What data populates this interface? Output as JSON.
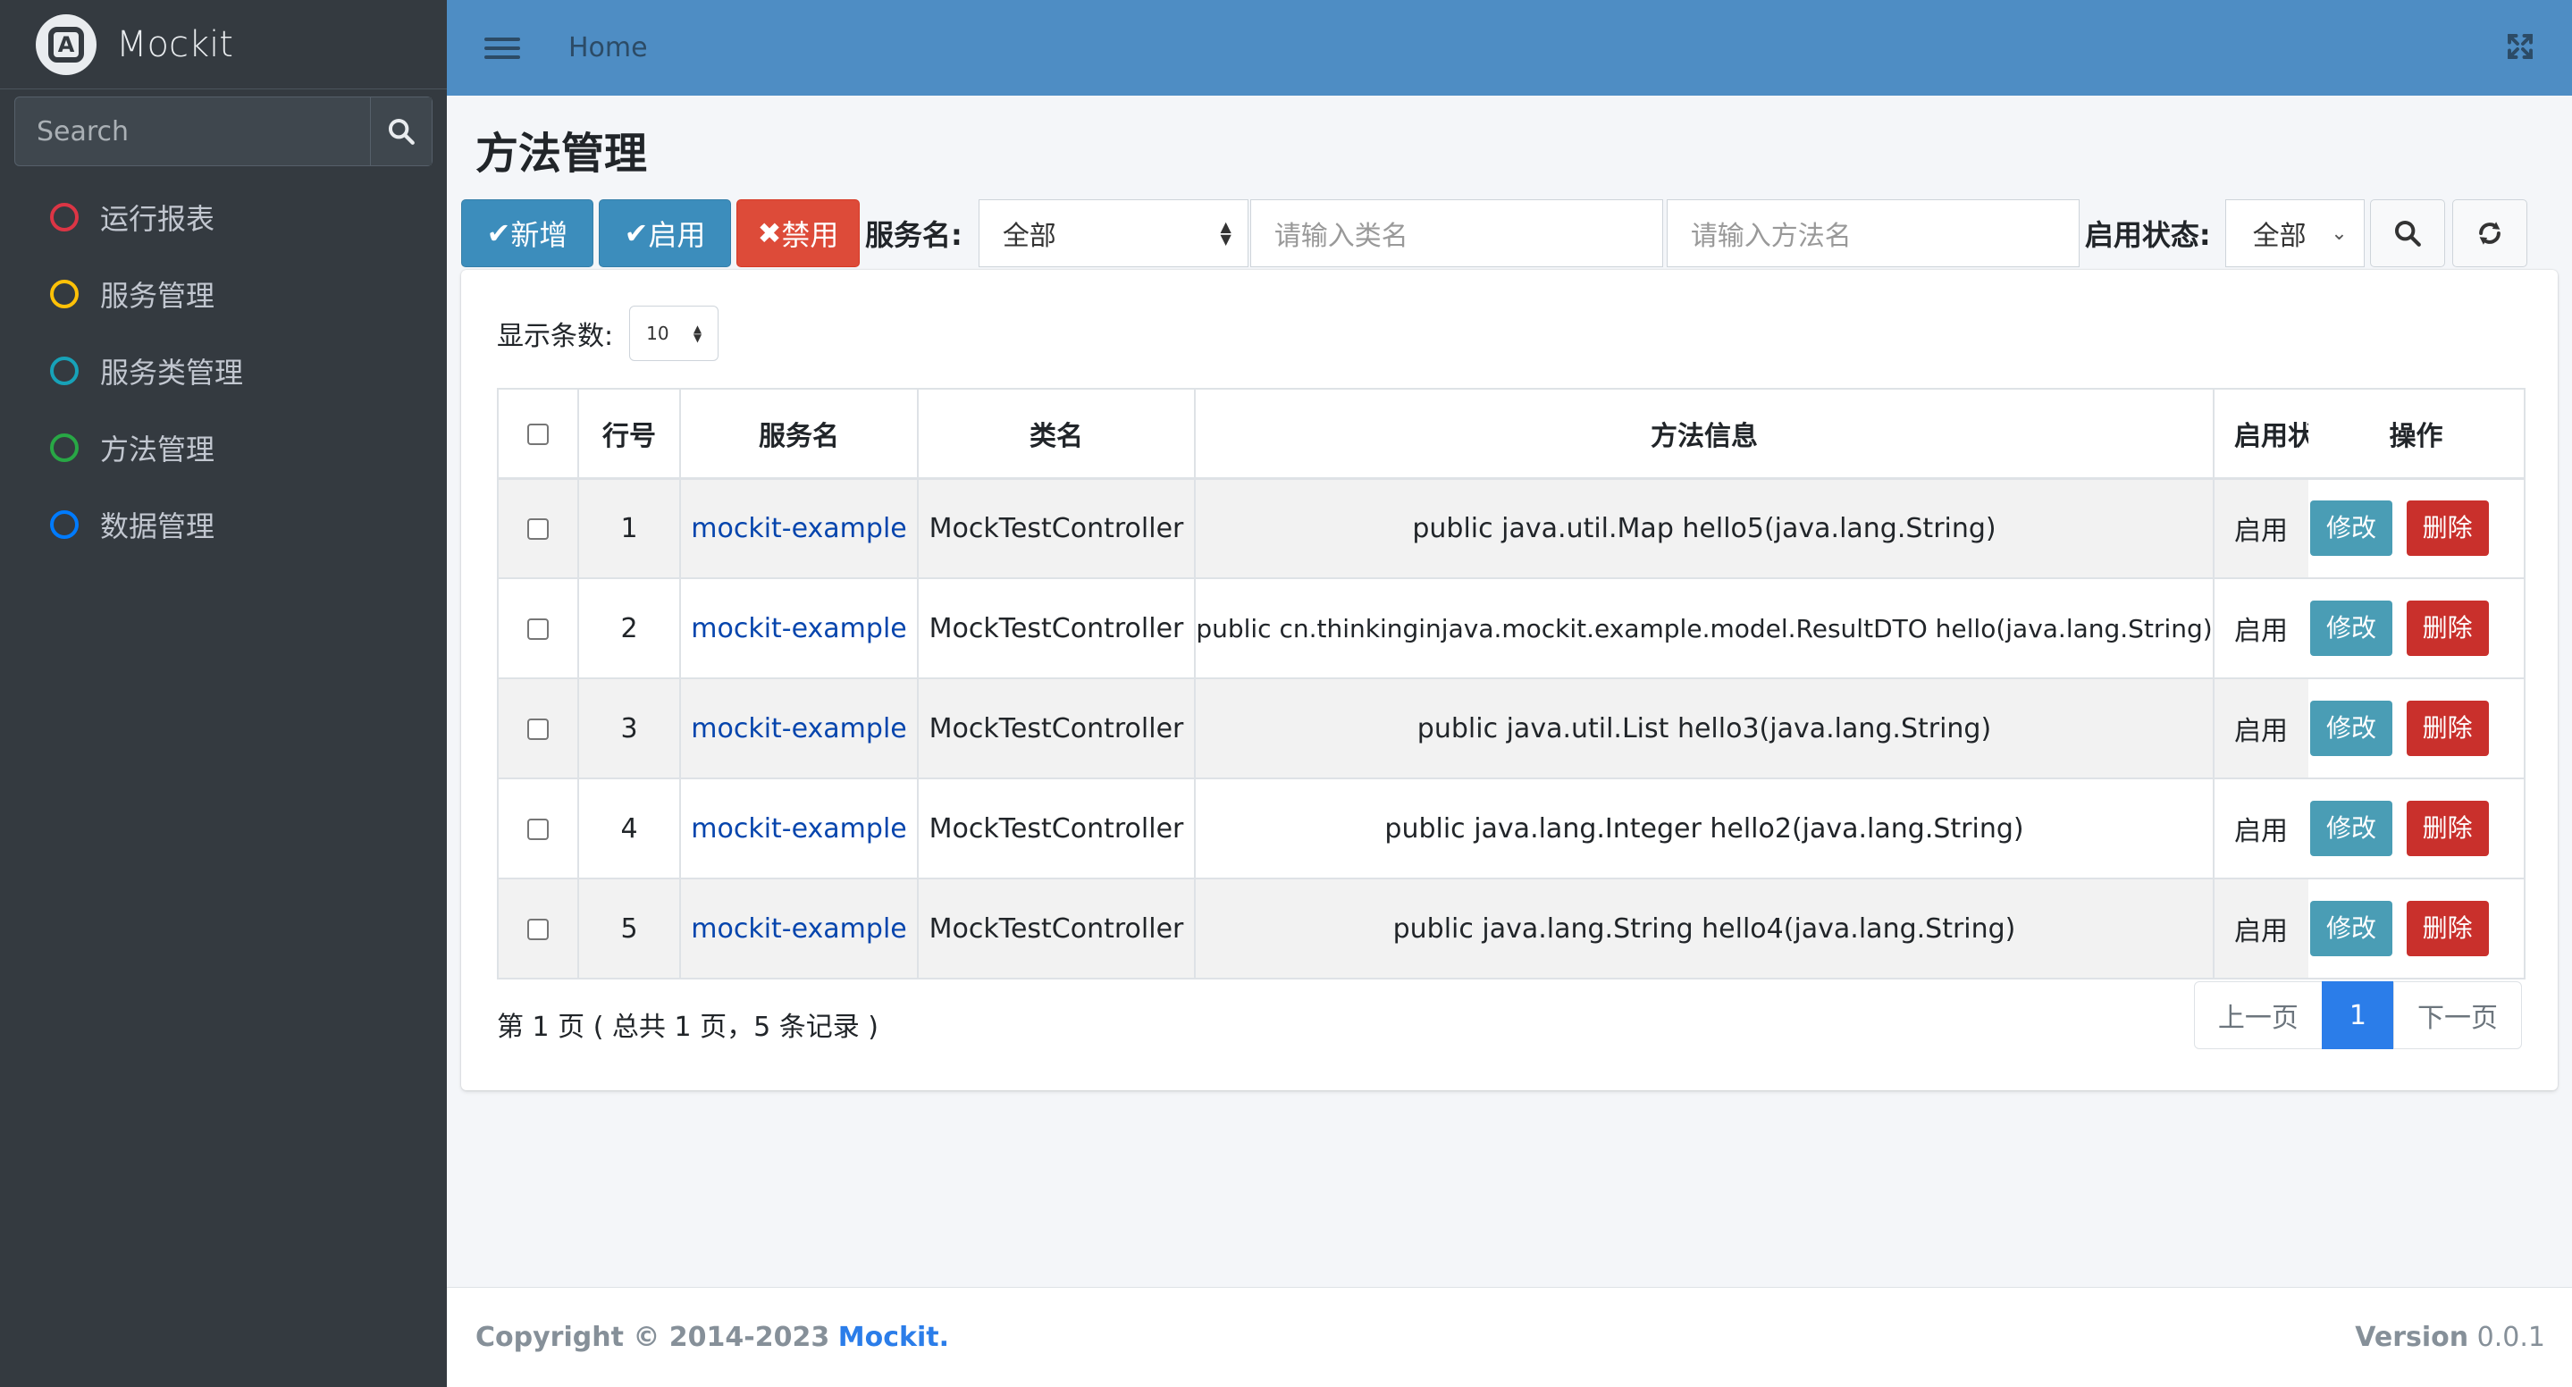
{
  "sidebar": {
    "brand": "Mockit",
    "search_placeholder": "Search",
    "items": [
      {
        "label": "运行报表",
        "color": "#dc3545"
      },
      {
        "label": "服务管理",
        "color": "#ffc107"
      },
      {
        "label": "服务类管理",
        "color": "#17a2b8"
      },
      {
        "label": "方法管理",
        "color": "#28a745"
      },
      {
        "label": "数据管理",
        "color": "#007bff"
      }
    ]
  },
  "header": {
    "home": "Home",
    "menu_icon": "hamburger-icon",
    "fullscreen_icon": "expand-icon"
  },
  "page": {
    "title": "方法管理"
  },
  "toolbar": {
    "add_label": "新增",
    "enable_label": "启用",
    "disable_label": "禁用",
    "service_label": "服务名:",
    "service_value": "全部",
    "class_placeholder": "请输入类名",
    "method_placeholder": "请输入方法名",
    "status_label": "启用状态:",
    "status_value": "全部"
  },
  "table": {
    "length_label": "显示条数:",
    "length_value": "10",
    "headers": {
      "row_no": "行号",
      "service": "服务名",
      "class": "类名",
      "method": "方法信息",
      "status": "启用状",
      "actions": "操作"
    },
    "rows": [
      {
        "no": "1",
        "service": "mockit-example",
        "class": "MockTestController",
        "method": "public java.util.Map hello5(java.lang.String)",
        "status": "启用"
      },
      {
        "no": "2",
        "service": "mockit-example",
        "class": "MockTestController",
        "method": "public cn.thinkinginjava.mockit.example.model.ResultDTO hello(java.lang.String)",
        "status": "启用"
      },
      {
        "no": "3",
        "service": "mockit-example",
        "class": "MockTestController",
        "method": "public java.util.List hello3(java.lang.String)",
        "status": "启用"
      },
      {
        "no": "4",
        "service": "mockit-example",
        "class": "MockTestController",
        "method": "public java.lang.Integer hello2(java.lang.String)",
        "status": "启用"
      },
      {
        "no": "5",
        "service": "mockit-example",
        "class": "MockTestController",
        "method": "public java.lang.String hello4(java.lang.String)",
        "status": "启用"
      }
    ],
    "edit_label": "修改",
    "delete_label": "删除"
  },
  "pagination": {
    "info": "第 1 页 ( 总共 1 页，5 条记录 )",
    "prev": "上一页",
    "current": "1",
    "next": "下一页"
  },
  "footer": {
    "copyright": "Copyright © 2014-2023",
    "brand": "Mockit.",
    "version_label": "Version",
    "version": "0.0.1"
  }
}
